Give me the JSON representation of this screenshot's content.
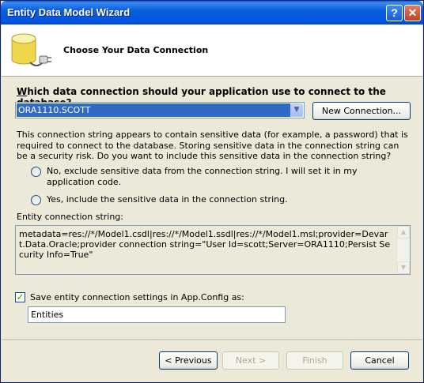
{
  "window": {
    "title": "Entity Data Model Wizard",
    "help_label": "?",
    "close_label": "✕"
  },
  "header": {
    "title": "Choose Your Data Connection",
    "icon": "database-plug-icon"
  },
  "question": {
    "mnemonic": "W",
    "rest": "hich data connection should your application use to connect to the database?"
  },
  "connection": {
    "selected": "ORA1110.SCOTT",
    "new_button": "New Connection..."
  },
  "sensitive_text": "This connection string appears to contain sensitive data (for example, a password) that is required to connect to the database. Storing sensitive data in the connection string can be a security risk. Do you want to include this sensitive data in the connection string?",
  "options": [
    {
      "label": "No, exclude sensitive data from the connection string. I will set it in my application code.",
      "selected": false
    },
    {
      "label": "Yes, include the sensitive data in the connection string.",
      "selected": false
    }
  ],
  "entity_connection": {
    "label": "Entity connection string:",
    "value": "metadata=res://*/Model1.csdl|res://*/Model1.ssdl|res://*/Model1.msl;provider=Devart.Data.Oracle;provider connection string=\"User Id=scott;Server=ORA1110;Persist Security Info=True\""
  },
  "save_settings": {
    "checked": true,
    "label": "Save entity connection settings in App.Config as:",
    "value": "Entities"
  },
  "buttons": {
    "previous": "< Previous",
    "next": "Next >",
    "finish": "Finish",
    "cancel": "Cancel"
  }
}
